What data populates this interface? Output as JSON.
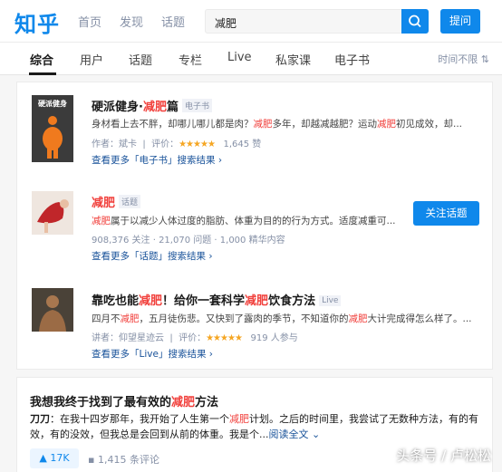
{
  "header": {
    "logo": "知乎",
    "nav": [
      "首页",
      "发现",
      "话题"
    ],
    "search_value": "减肥",
    "ask_label": "提问"
  },
  "tabs": {
    "items": [
      "综合",
      "用户",
      "话题",
      "专栏",
      "Live",
      "私家课",
      "电子书"
    ],
    "active": "综合",
    "sort_label": "时间不限"
  },
  "results": {
    "ebook": {
      "title_pre": "硬派健身·",
      "title_hl": "减肥",
      "title_post": "篇",
      "tag": "电子书",
      "cover_text": "硬派健身",
      "desc_pre": "身材看上去不胖，却哪儿哪儿都是肉？",
      "desc_hl1": "减肥",
      "desc_mid1": "多年，却越减越肥？运动",
      "desc_hl2": "减肥",
      "desc_post": "初见成效，却...",
      "author": "作者：斌卡",
      "rating_label": "评价：",
      "rating_stars": "★★★★★",
      "likes": "1,645 赞",
      "more_label": "查看更多「电子书」搜索结果 ›"
    },
    "topic": {
      "title_hl": "减肥",
      "tag": "话题",
      "desc_hl": "减肥",
      "desc_post": "属于以减少人体过度的脂肪、体重为目的的行为方式。适度减重可...",
      "stats": "908,376 关注 · 21,070 问题 · 1,000 精华内容",
      "follow_label": "关注话题",
      "more_label": "查看更多「话题」搜索结果 ›"
    },
    "live": {
      "title_pre": "靠吃也能",
      "title_hl1": "减肥",
      "title_mid": "！给你一套科学",
      "title_hl2": "减肥",
      "title_post": "饮食方法",
      "tag": "Live",
      "desc_pre": "四月不",
      "desc_hl1": "减肥",
      "desc_mid": "，五月徒伤悲。又快到了露肉的季节，不知道你的",
      "desc_hl2": "减肥",
      "desc_post": "大计完成得怎么样了。...",
      "speaker": "讲者：仰望星迹云",
      "rating_label": "评价：",
      "rating_stars": "★★★★★",
      "participants": "919 人参与",
      "more_label": "查看更多「Live」搜索结果 ›"
    }
  },
  "answer": {
    "title_pre": "我想我终于找到了最有效的",
    "title_hl": "减肥",
    "title_post": "方法",
    "author": "刀刀",
    "line1_pre": "：在我十四岁那年，我开始了人生第一个",
    "line1_hl": "减肥",
    "line1_post": "计划。之后的时间里，我尝试了无数种方法，有的有",
    "line2": "效，有的没效，但我总是会回到从前的体重。我是个...",
    "read_more": "阅读全文 ⌄",
    "votes": "▲ 17K",
    "comments": "▪ 1,415 条评论"
  },
  "watermark": "头条号 / 卢松松",
  "colors": {
    "brand": "#0f88eb",
    "highlight": "#f1403c",
    "link": "#175199",
    "meta": "#8590a6",
    "star": "#f5a623"
  }
}
